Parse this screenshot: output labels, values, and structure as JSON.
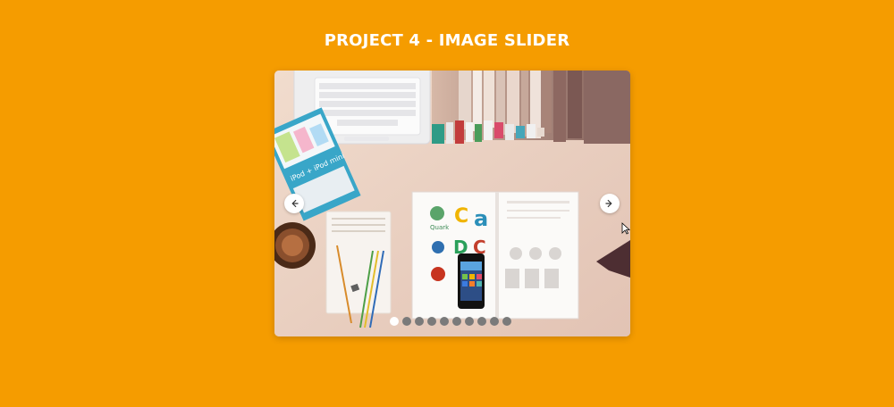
{
  "page": {
    "title": "PROJECT 4 - IMAGE SLIDER",
    "background_color": "#f59c00"
  },
  "slider": {
    "image_description": "desk-workspace-photo",
    "ipod_box_text": "iPod + iPod mini",
    "book_logo_text": "Quark",
    "prev_icon": "arrow-left-icon",
    "next_icon": "arrow-right-icon",
    "slide_count": 10,
    "active_slide": 1,
    "dot_color": "#7a7a7a",
    "active_dot_color": "#ffffff"
  }
}
